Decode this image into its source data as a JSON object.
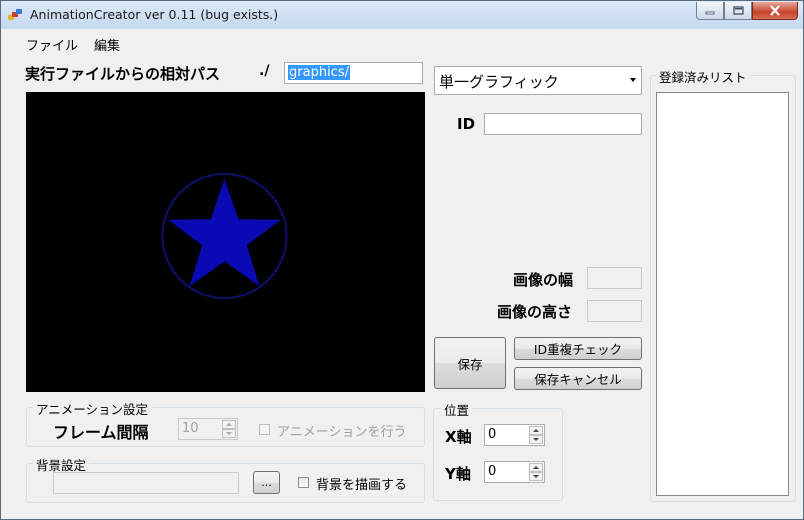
{
  "window": {
    "title": "AnimationCreator ver 0.11 (bug exists.)"
  },
  "menu": {
    "file": "ファイル",
    "edit": "編集"
  },
  "path": {
    "label": "実行ファイルからの相対パス",
    "prefix": "./",
    "value": "graphics/"
  },
  "graphic_type": {
    "selected": "単一グラフィック"
  },
  "id_field": {
    "label": "ID",
    "value": ""
  },
  "image_size": {
    "width_label": "画像の幅",
    "width_value": "",
    "height_label": "画像の高さ",
    "height_value": ""
  },
  "buttons": {
    "save": "保存",
    "id_check": "ID重複チェック",
    "cancel_save": "保存キャンセル",
    "browse": "..."
  },
  "animation": {
    "group_title": "アニメーション設定",
    "frame_interval_label": "フレーム間隔",
    "frame_interval_value": "10",
    "animate_label": "アニメーションを行う",
    "animate_checked": false
  },
  "background": {
    "group_title": "背景設定",
    "path_value": "",
    "draw_label": "背景を描画する",
    "draw_checked": false
  },
  "position": {
    "group_title": "位置",
    "x_label": "X軸",
    "x_value": "0",
    "y_label": "Y軸",
    "y_value": "0"
  },
  "registered_list": {
    "title": "登録済みリスト",
    "items": []
  },
  "preview": {
    "background_color": "#000000",
    "star_color": "#0a0ab4",
    "circle_color": "#10106e"
  }
}
